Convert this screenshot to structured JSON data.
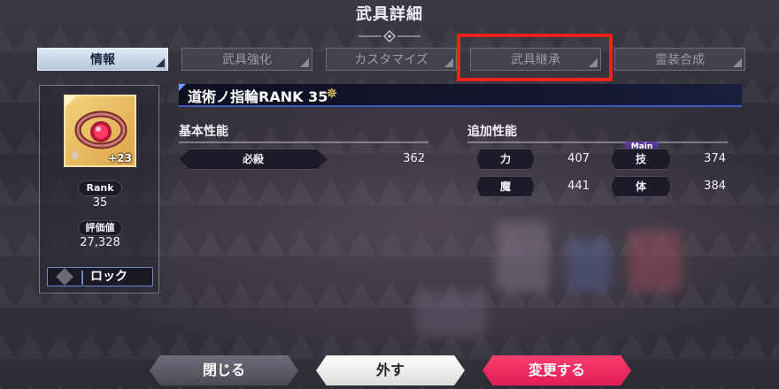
{
  "header": {
    "title": "武具詳細"
  },
  "tabs": [
    {
      "label": "情報",
      "active": true
    },
    {
      "label": "武具強化",
      "active": false
    },
    {
      "label": "カスタマイズ",
      "active": false
    },
    {
      "label": "武具継承",
      "active": false
    },
    {
      "label": "霊装合成",
      "active": false
    }
  ],
  "item": {
    "plus_level": "+23",
    "rank_label": "Rank",
    "rank_value": "35",
    "score_label": "評価値",
    "score_value": "27,328",
    "lock_label": "ロック",
    "name": "道術ノ指輪RANK 35",
    "name_badge": "✵"
  },
  "basic_stats": {
    "heading": "基本性能",
    "rows": [
      {
        "label": "必殺",
        "value": "362"
      }
    ]
  },
  "extra_stats": {
    "heading": "追加性能",
    "main_tag": "Main",
    "rows": [
      {
        "label": "力",
        "value": "407"
      },
      {
        "label": "技",
        "value": "374"
      },
      {
        "label": "魔",
        "value": "441"
      },
      {
        "label": "体",
        "value": "384"
      }
    ]
  },
  "buttons": {
    "close": "閉じる",
    "remove": "外す",
    "change": "変更する"
  },
  "colors": {
    "highlight": "#f0221a",
    "change_button": "#e01d55",
    "active_tab": "#b7c6db",
    "name_bar_border": "#3f5ab8"
  }
}
